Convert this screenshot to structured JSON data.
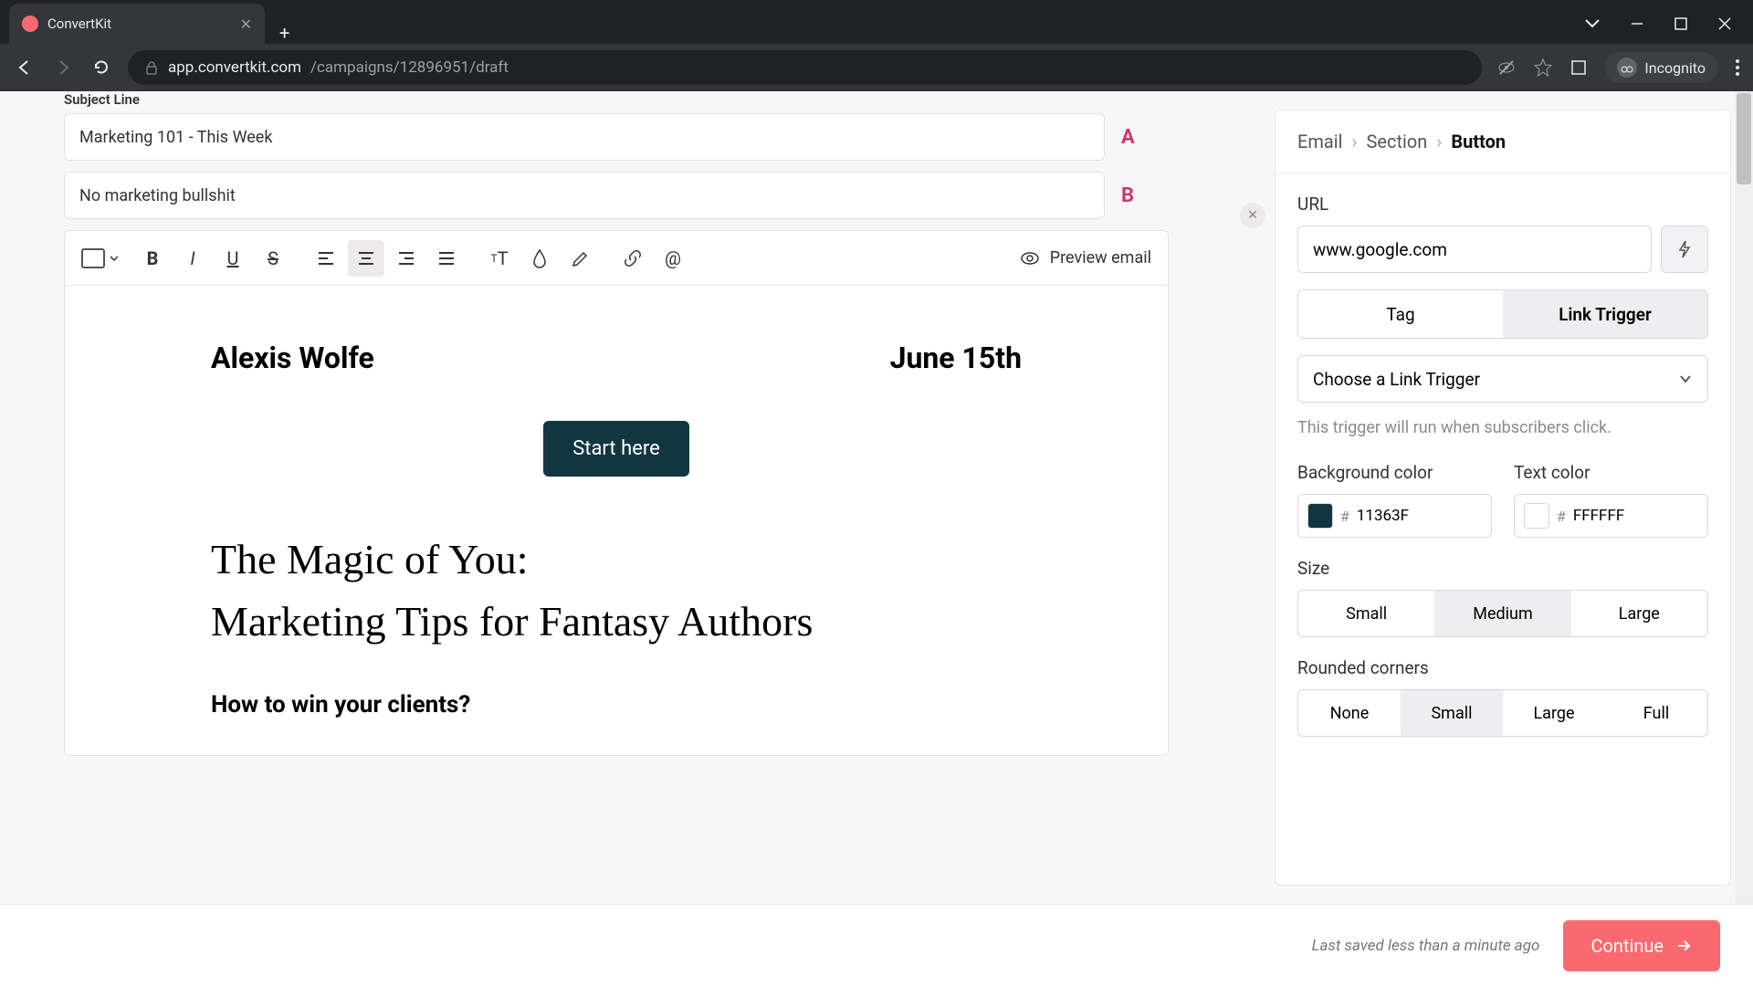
{
  "browser": {
    "tab_title": "ConvertKit",
    "url_host": "app.convertkit.com",
    "url_path": "/campaigns/12896951/draft",
    "incognito_label": "Incognito"
  },
  "editor": {
    "subject_label": "Subject Line",
    "subject_a": "Marketing 101 - This Week",
    "subject_b": "No marketing bullshit",
    "ab_a": "A",
    "ab_b": "B",
    "preview_label": "Preview email",
    "content": {
      "author": "Alexis Wolfe",
      "date": "June 15th",
      "cta": "Start here",
      "heading1": "The Magic of You:",
      "heading2": "Marketing Tips for Fantasy Authors",
      "subhead": "How to win your clients?"
    }
  },
  "sidebar": {
    "crumbs": {
      "email": "Email",
      "section": "Section",
      "button": "Button"
    },
    "url_label": "URL",
    "url_value": "www.google.com",
    "tabs": {
      "tag": "Tag",
      "link_trigger": "Link Trigger"
    },
    "trigger_select": "Choose a Link Trigger",
    "trigger_hint": "This trigger will run when subscribers click.",
    "bg_label": "Background color",
    "text_label": "Text color",
    "bg_hex": "11363F",
    "text_hex": "FFFFFF",
    "size_label": "Size",
    "sizes": {
      "s": "Small",
      "m": "Medium",
      "l": "Large"
    },
    "corners_label": "Rounded corners",
    "corners": {
      "none": "None",
      "small": "Small",
      "large": "Large",
      "full": "Full"
    }
  },
  "footer": {
    "saved": "Last saved less than a minute ago",
    "continue": "Continue"
  }
}
